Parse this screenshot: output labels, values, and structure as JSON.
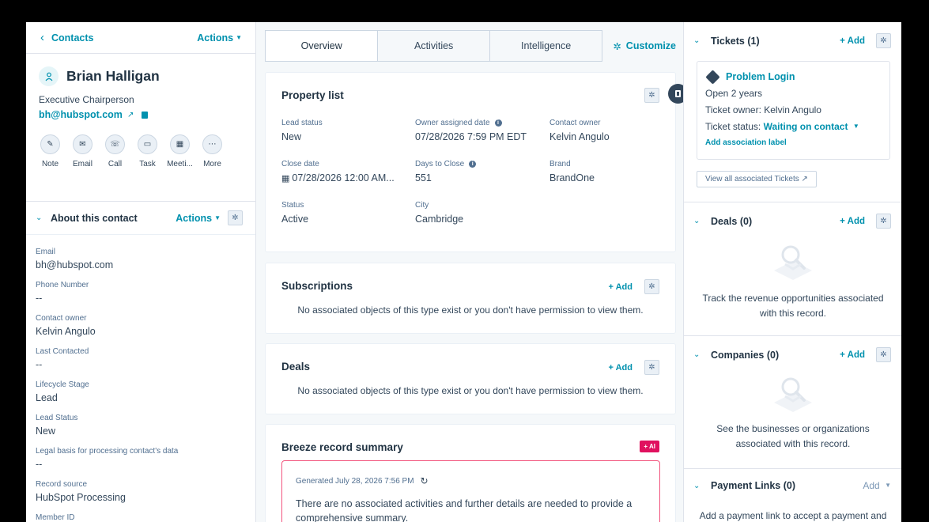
{
  "left": {
    "back_label": "Contacts",
    "actions_label": "Actions",
    "name": "Brian Halligan",
    "job_title": "Executive Chairperson",
    "email": "bh@hubspot.com",
    "quick_actions": [
      {
        "label": "Note",
        "icon": "pencil-icon"
      },
      {
        "label": "Email",
        "icon": "envelope-icon"
      },
      {
        "label": "Call",
        "icon": "phone-icon"
      },
      {
        "label": "Task",
        "icon": "task-icon"
      },
      {
        "label": "Meeti...",
        "icon": "calendar-icon"
      },
      {
        "label": "More",
        "icon": "ellipsis-icon"
      }
    ],
    "about_title": "About this contact",
    "about_actions": "Actions",
    "properties": [
      {
        "label": "Email",
        "value": "bh@hubspot.com"
      },
      {
        "label": "Phone Number",
        "value": "--"
      },
      {
        "label": "Contact owner",
        "value": "Kelvin Angulo"
      },
      {
        "label": "Last Contacted",
        "value": "--"
      },
      {
        "label": "Lifecycle Stage",
        "value": "Lead"
      },
      {
        "label": "Lead Status",
        "value": "New"
      },
      {
        "label": "Legal basis for processing contact's data",
        "value": "--"
      },
      {
        "label": "Record source",
        "value": "HubSpot Processing"
      },
      {
        "label": "Member ID",
        "value": ""
      }
    ]
  },
  "middle": {
    "tabs": [
      "Overview",
      "Activities",
      "Intelligence"
    ],
    "customize_label": "Customize",
    "property_list": {
      "title": "Property list",
      "items": [
        {
          "label": "Lead status",
          "value": "New",
          "info": false
        },
        {
          "label": "Owner assigned date",
          "value": "07/28/2026 7:59 PM EDT",
          "info": true
        },
        {
          "label": "Contact owner",
          "value": "Kelvin Angulo",
          "info": false
        },
        {
          "label": "Close date",
          "value": "07/28/2026 12:00 AM...",
          "info": false
        },
        {
          "label": "Days to Close",
          "value": "551",
          "info": true
        },
        {
          "label": "Brand",
          "value": "BrandOne",
          "info": false
        },
        {
          "label": "Status",
          "value": "Active",
          "info": false
        },
        {
          "label": "City",
          "value": "Cambridge",
          "info": false
        }
      ]
    },
    "subscriptions": {
      "title": "Subscriptions",
      "add": "+ Add",
      "empty": "No associated objects of this type exist or you don't have permission to view them."
    },
    "deals": {
      "title": "Deals",
      "add": "+ Add",
      "empty": "No associated objects of this type exist or you don't have permission to view them."
    },
    "breeze": {
      "title": "Breeze record summary",
      "badge": "+ AI",
      "generated": "Generated July 28, 2026 7:56 PM",
      "text": "There are no associated activities and further details are needed to provide a comprehensive summary."
    }
  },
  "right": {
    "tickets": {
      "title": "Tickets (1)",
      "add": "+ Add",
      "ticket_name": "Problem Login",
      "open": "Open 2 years",
      "owner": "Ticket owner: Kelvin Angulo",
      "status_label": "Ticket status:",
      "status_value": "Waiting on contact",
      "assoc_label": "Add association label",
      "view_all": "View all associated Tickets"
    },
    "deals": {
      "title": "Deals (0)",
      "add": "+ Add",
      "empty": "Track the revenue opportunities associated with this record."
    },
    "companies": {
      "title": "Companies (0)",
      "add": "+ Add",
      "empty": "See the businesses or organizations associated with this record."
    },
    "payment_links": {
      "title": "Payment Links (0)",
      "add": "Add",
      "empty": "Add a payment link to accept a payment and"
    }
  },
  "colors": {
    "accent": "#0091ae",
    "text": "#33475b",
    "ai": "#e0115f",
    "border": "#dfe3eb"
  }
}
